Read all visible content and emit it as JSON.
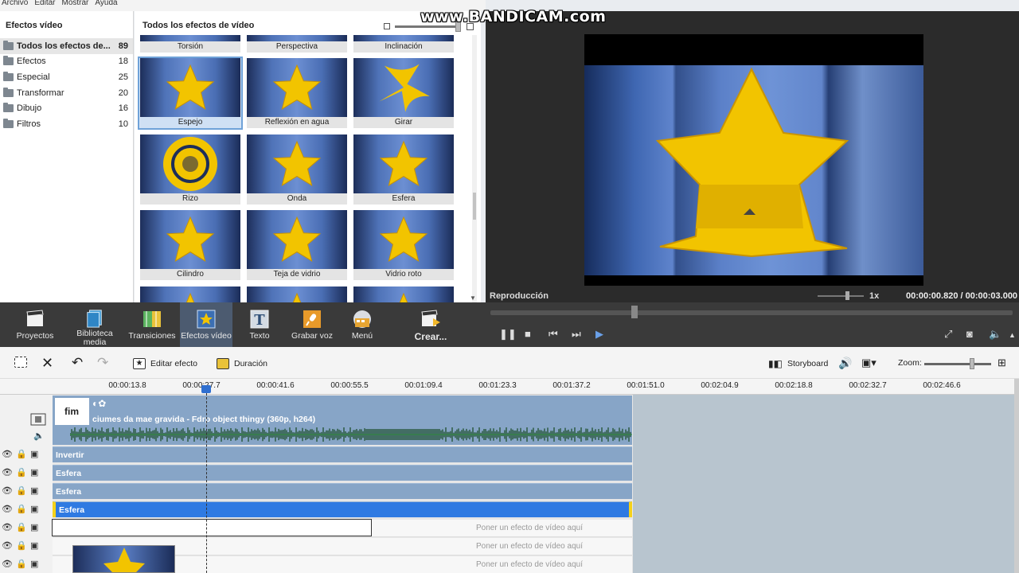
{
  "menu": [
    "Archivo",
    "Editar",
    "Mostrar",
    "Ayuda"
  ],
  "watermark": "www.BANDICAM.com",
  "categories": {
    "title": "Efectos vídeo",
    "items": [
      {
        "label": "Todos los efectos de...",
        "count": "89"
      },
      {
        "label": "Efectos",
        "count": "18"
      },
      {
        "label": "Especial",
        "count": "25"
      },
      {
        "label": "Transformar",
        "count": "20"
      },
      {
        "label": "Dibujo",
        "count": "16"
      },
      {
        "label": "Filtros",
        "count": "10"
      }
    ]
  },
  "grid": {
    "title": "Todos los efectos de vídeo",
    "top_row": [
      "Torsión",
      "Perspectiva",
      "Inclinación"
    ],
    "tiles": [
      {
        "label": "Espejo",
        "selected": true
      },
      {
        "label": "Reflexión en agua"
      },
      {
        "label": "Girar"
      },
      {
        "label": "Rizo"
      },
      {
        "label": "Onda"
      },
      {
        "label": "Esfera"
      },
      {
        "label": "Cilindro"
      },
      {
        "label": "Teja de vidrio"
      },
      {
        "label": "Vidrio roto"
      }
    ]
  },
  "preview": {
    "label": "Reproducción",
    "speed": "1x",
    "time": "00:00:00.820 / 00:00:03.000",
    "colors": {
      "star": "#f2c400",
      "background": "#4f73b8"
    }
  },
  "toolbar": {
    "items": [
      {
        "label": "Proyectos",
        "icon": "clapper-icon"
      },
      {
        "label": "Biblioteca media",
        "icon": "film-library-icon"
      },
      {
        "label": "Transiciones",
        "icon": "transition-icon"
      },
      {
        "label": "Efectos vídeo",
        "icon": "star-effect-icon",
        "active": true
      },
      {
        "label": "Texto",
        "icon": "text-icon"
      },
      {
        "label": "Grabar voz",
        "icon": "microphone-icon"
      },
      {
        "label": "Menú",
        "icon": "menu-disc-icon"
      },
      {
        "label": "Crear...",
        "icon": "create-icon"
      }
    ]
  },
  "timeline_toolbar": {
    "edit_effect": "Editar efecto",
    "duration": "Duración",
    "storyboard": "Storyboard",
    "zoom": "Zoom:"
  },
  "ruler": {
    "ticks": [
      "00:00:13.8",
      "00:00:27.7",
      "00:00:41.6",
      "00:00:55.5",
      "00:01:09.4",
      "00:01:23.3",
      "00:01:37.2",
      "00:01:51.0",
      "00:02:04.9",
      "00:02:18.8",
      "00:02:32.7",
      "00:02:46.6"
    ]
  },
  "timeline": {
    "clip_thumb_text": "fim",
    "clip_title": "ciumes da mae gravida - Fdrp object thingy (360p, h264)",
    "effect_rows": [
      "Invertir",
      "Esfera",
      "Esfera",
      "Esfera"
    ],
    "placeholder": "Poner un efecto de vídeo aquí"
  }
}
